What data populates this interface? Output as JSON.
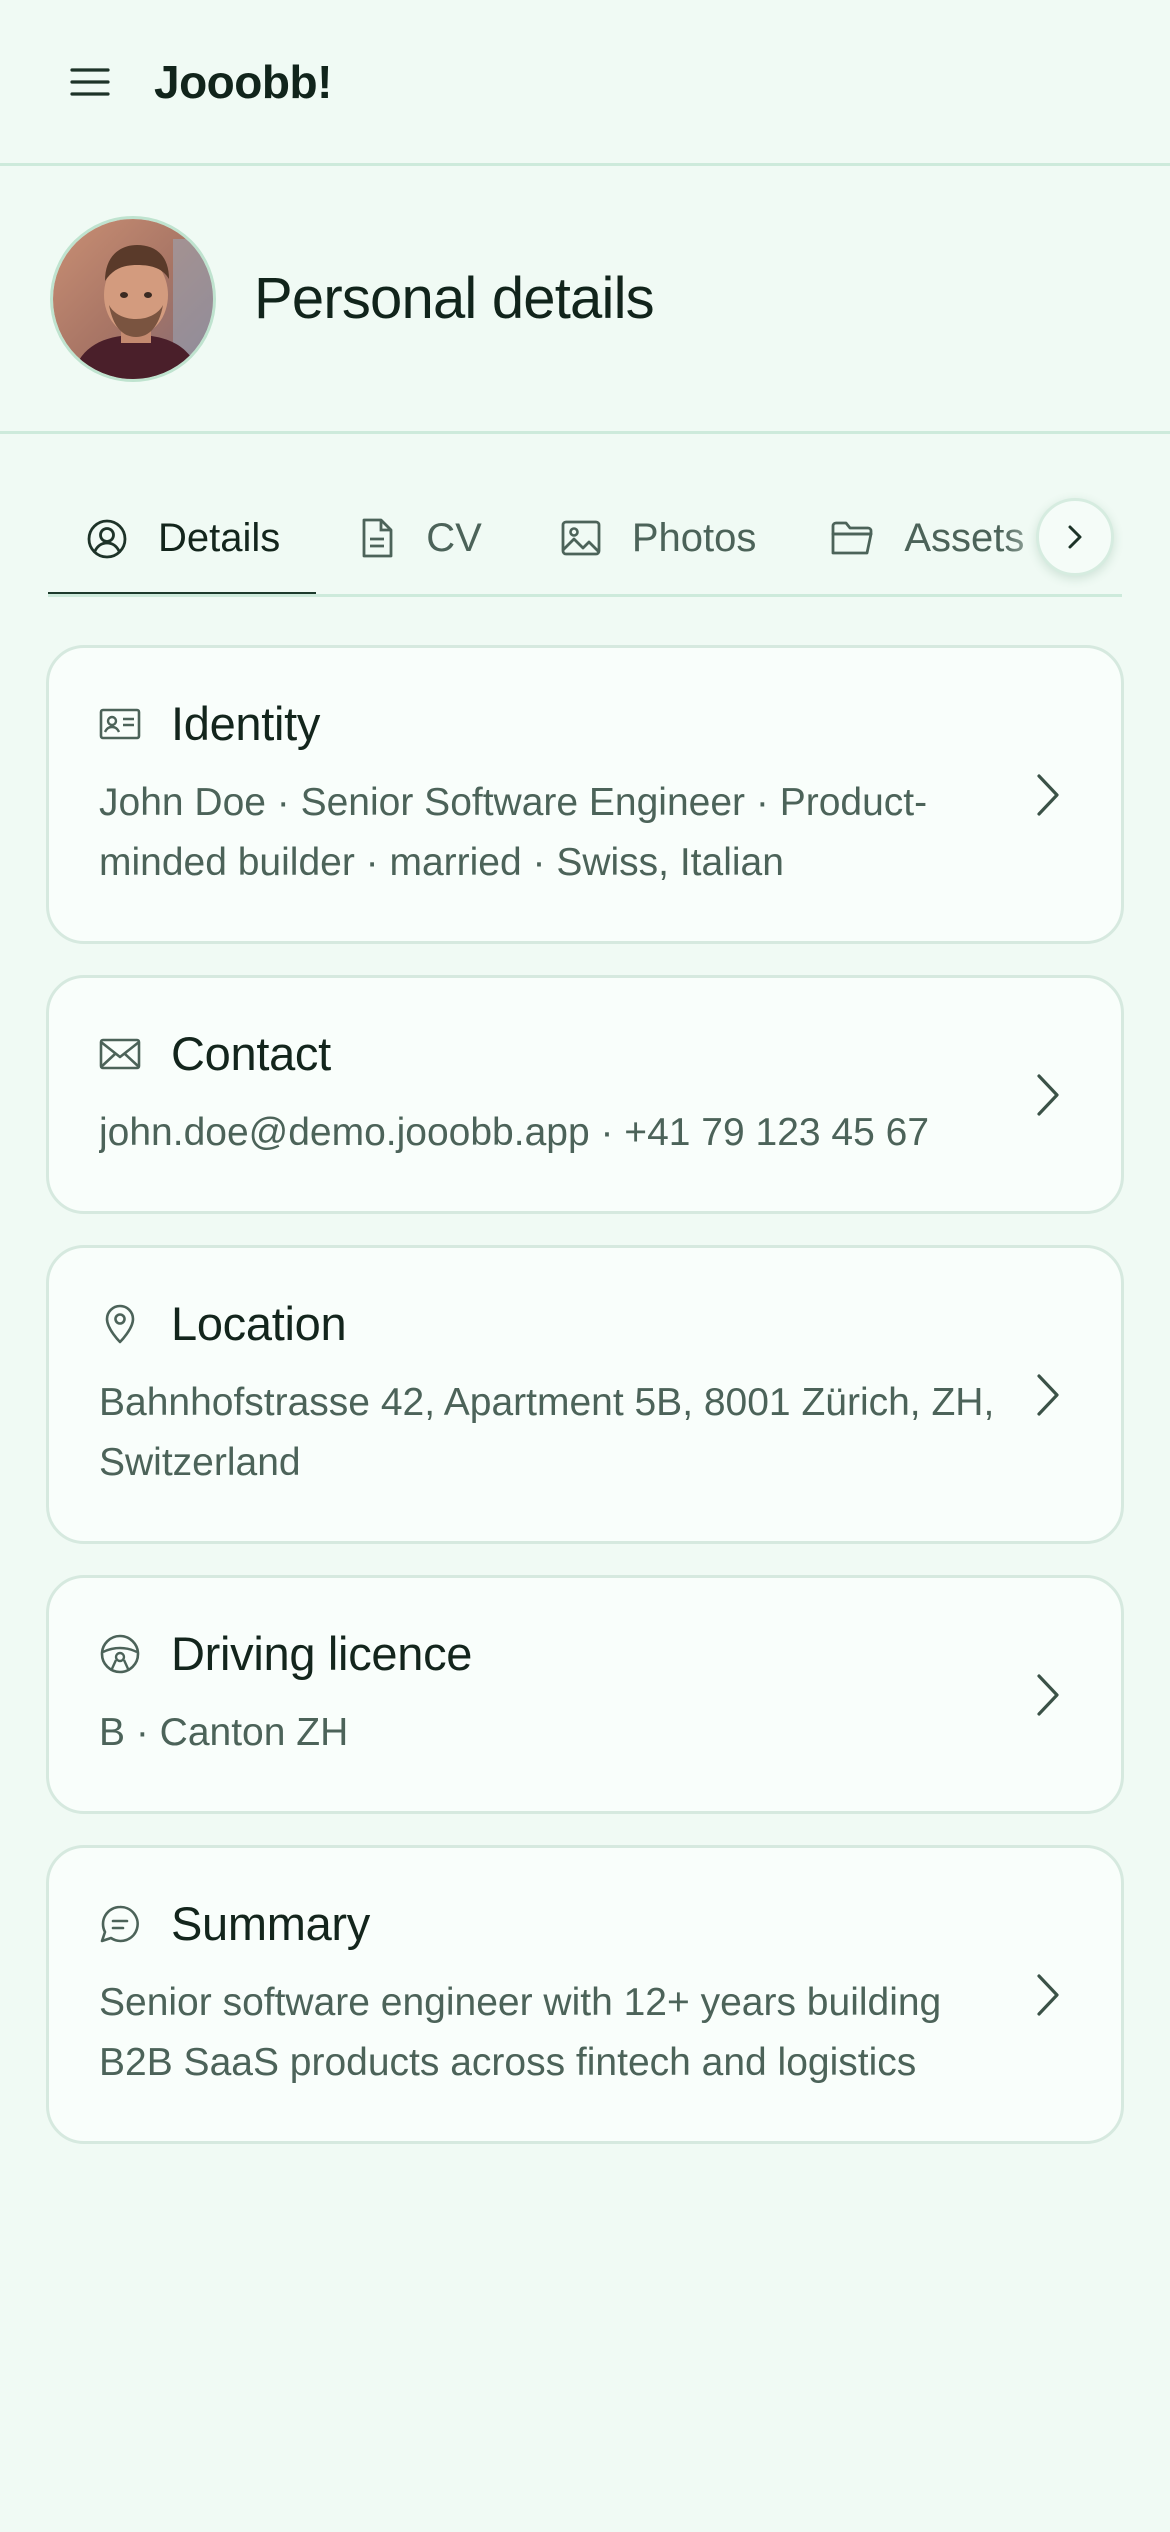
{
  "app": {
    "title": "Jooobb!"
  },
  "profile": {
    "title": "Personal details"
  },
  "tabs": [
    {
      "label": "Details",
      "icon": "user-circle-icon",
      "active": true
    },
    {
      "label": "CV",
      "icon": "document-icon",
      "active": false
    },
    {
      "label": "Photos",
      "icon": "image-icon",
      "active": false
    },
    {
      "label": "Assets",
      "icon": "folder-icon",
      "active": false
    }
  ],
  "cards": [
    {
      "title": "Identity",
      "icon": "id-card-icon",
      "body": "John Doe · Senior Software Engineer · Product-minded builder · married · Swiss, Italian"
    },
    {
      "title": "Contact",
      "icon": "mail-icon",
      "body": "john.doe@demo.jooobb.app · +41 79 123 45 67"
    },
    {
      "title": "Location",
      "icon": "map-pin-icon",
      "body": "Bahnhofstrasse 42, Apartment 5B, 8001 Zürich, ZH, Switzerland"
    },
    {
      "title": "Driving licence",
      "icon": "steering-wheel-icon",
      "body": "B · Canton ZH"
    },
    {
      "title": "Summary",
      "icon": "chat-icon",
      "body": "Senior software engineer with 12+ years building B2B SaaS products across fintech and logistics"
    }
  ],
  "colors": {
    "background": "#f0faf4",
    "card": "#f9fefb",
    "border": "#d6e9df",
    "text": "#13251c",
    "muted": "#4c6359"
  }
}
